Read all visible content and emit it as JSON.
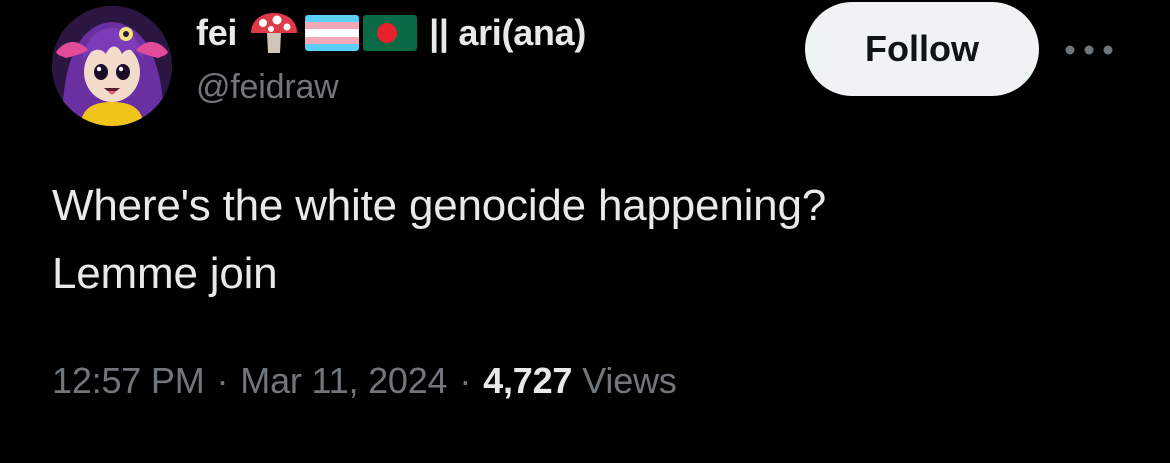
{
  "author": {
    "display_name": "fei",
    "name_emojis": [
      "mushroom-emoji",
      "transgender-flag-emoji",
      "bangladesh-flag-emoji"
    ],
    "name_suffix": "|| ari(ana)",
    "handle": "@feidraw",
    "avatar": "anime-girl-avatar"
  },
  "actions": {
    "follow_label": "Follow",
    "more_icon": "more-horizontal-icon"
  },
  "tweet": {
    "text_lines": [
      "Where's the white genocide happening?",
      "Lemme join"
    ]
  },
  "meta": {
    "time": "12:57 PM",
    "date": "Mar 11, 2024",
    "separator": "·",
    "views_count": "4,727",
    "views_label": "Views"
  },
  "colors": {
    "background": "#000000",
    "primary_text": "#e7e9ea",
    "secondary_text": "#71767b",
    "follow_bg": "#eff3f4",
    "follow_text": "#0f1419"
  }
}
